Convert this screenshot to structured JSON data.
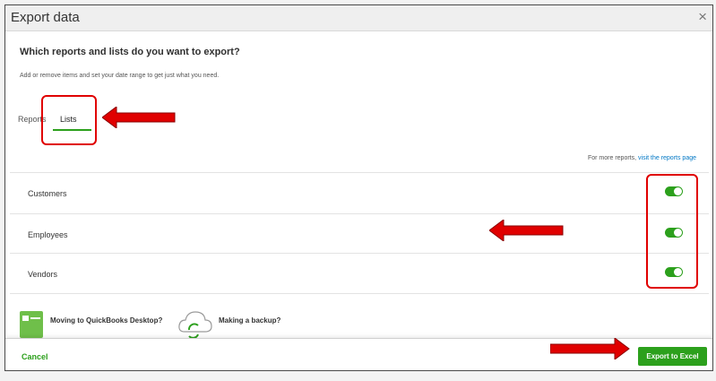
{
  "dialog": {
    "title": "Export data",
    "close_glyph": "×"
  },
  "main": {
    "heading": "Which reports and lists do you want to export?",
    "subtext": "Add or remove items and set your date range to get just what you need."
  },
  "tabs": [
    {
      "label": "Reports",
      "active": false
    },
    {
      "label": "Lists",
      "active": true
    }
  ],
  "reports_hint": {
    "prefix": "For more reports,",
    "link": "visit the reports page"
  },
  "lists": [
    {
      "label": "Customers",
      "enabled": true
    },
    {
      "label": "Employees",
      "enabled": true
    },
    {
      "label": "Vendors",
      "enabled": true
    }
  ],
  "promos": [
    {
      "title": "Moving to QuickBooks Desktop?",
      "icon": "desktop-doc-icon"
    },
    {
      "title": "Making a backup?",
      "icon": "cloud-sync-icon"
    }
  ],
  "footer": {
    "cancel_label": "Cancel",
    "export_label": "Export to Excel"
  },
  "colors": {
    "accent_green": "#2ca01c",
    "link_blue": "#0077c5",
    "annotation_red": "#e00000"
  }
}
